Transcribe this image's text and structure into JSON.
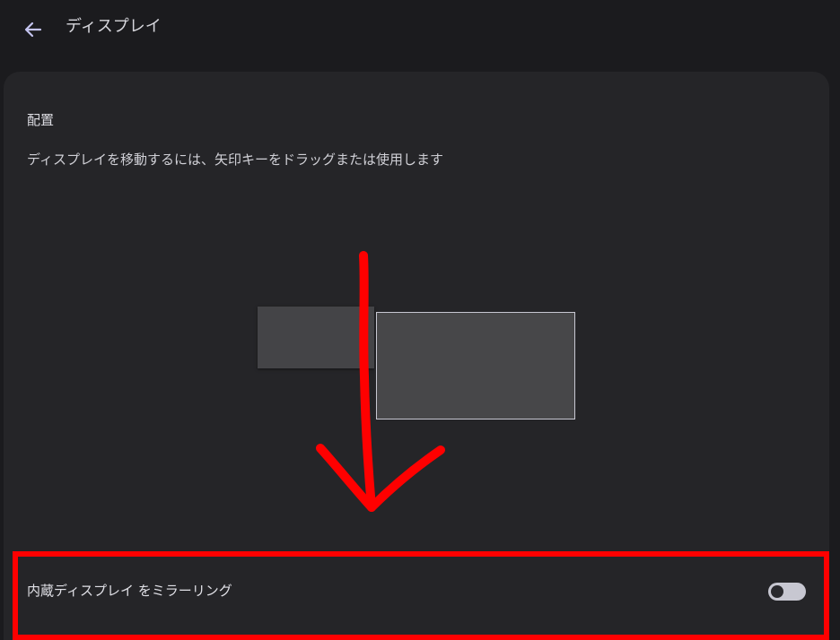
{
  "header": {
    "back_icon": "arrow-left-icon",
    "title": "ディスプレイ"
  },
  "arrangement": {
    "heading": "配置",
    "description": "ディスプレイを移動するには、矢印キーをドラッグまたは使用します",
    "displays": [
      {
        "name": "secondary-display"
      },
      {
        "name": "primary-display"
      }
    ]
  },
  "mirror": {
    "label": "内蔵ディスプレイ をミラーリング",
    "enabled": false
  },
  "colors": {
    "background": "#1b1b1e",
    "card": "#252528",
    "annotation": "#ff0000",
    "toggle_track": "#c7c7d1"
  },
  "annotations": {
    "arrow": "red-down-arrow-icon",
    "highlight": "red-highlight-box"
  }
}
